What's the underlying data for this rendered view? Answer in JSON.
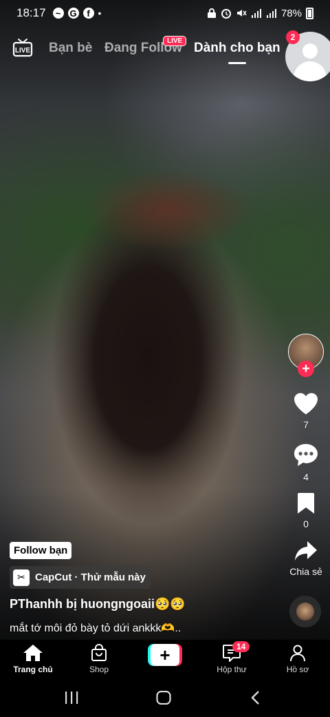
{
  "status_bar": {
    "time": "18:17",
    "battery": "78%",
    "left_icons": [
      "messenger-icon",
      "google-icon",
      "facebook-icon",
      "dot-icon"
    ],
    "right_icons": [
      "lock-icon",
      "alarm-icon",
      "mute-icon",
      "signal-icon",
      "signal-icon"
    ]
  },
  "top_nav": {
    "tabs": [
      {
        "label": "Bạn bè"
      },
      {
        "label": "Đang Follow"
      },
      {
        "label": "Dành cho bạn"
      }
    ],
    "live_badge": "LIVE",
    "profile_notifications": "2"
  },
  "video": {
    "actions": {
      "likes": "7",
      "comments": "4",
      "saves": "0",
      "share_label": "Chia sẻ"
    },
    "follow_chip": "Follow bạn",
    "template_chip": "CapCut · Thử mẫu này",
    "username": "PThanhh bị huongngoaii🥺🥺",
    "caption": "mắt tớ môi đỏ bày tỏ dứi ankkk🫶.."
  },
  "bottom_nav": {
    "items": [
      {
        "label": "Trang chủ"
      },
      {
        "label": "Shop"
      },
      {
        "label": "Hộp thư"
      },
      {
        "label": "Hồ sơ"
      }
    ],
    "inbox_badge": "14"
  },
  "colors": {
    "accent_red": "#fe2c55",
    "accent_cyan": "#25f4ee",
    "background": "#000000"
  }
}
